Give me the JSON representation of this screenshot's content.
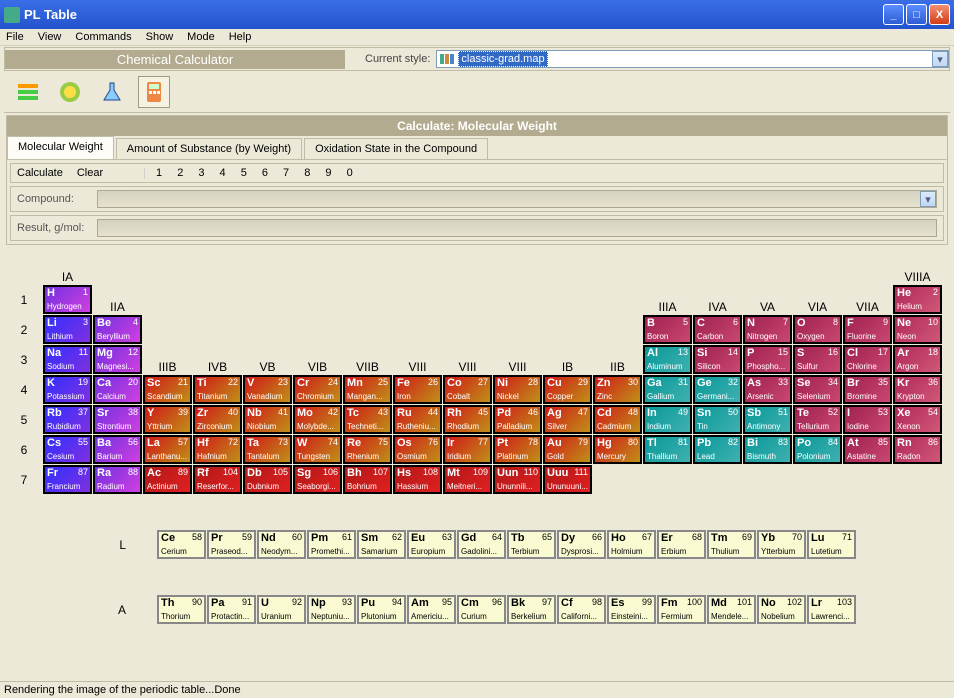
{
  "window": {
    "title": "PL Table"
  },
  "menu": [
    "File",
    "View",
    "Commands",
    "Show",
    "Mode",
    "Help"
  ],
  "header_label": "Chemical Calculator",
  "style": {
    "label": "Current style:",
    "value": "classic-grad.map"
  },
  "panel_title": "Calculate: Molecular Weight",
  "tabs": [
    "Molecular Weight",
    "Amount of Substance (by Weight)",
    "Oxidation State in the Compound"
  ],
  "calc": {
    "btn_calculate": "Calculate",
    "btn_clear": "Clear",
    "digits": "1 2 3 4 5 6 7 8 9 0",
    "compound_label": "Compound:",
    "result_label": "Result, g/mol:"
  },
  "groups": {
    "IA": "IA",
    "IIA": "IIA",
    "IIIB": "IIIB",
    "IVB": "IVB",
    "VB": "VB",
    "VIB": "VIB",
    "VIIB": "VIIB",
    "VIII1": "VIII",
    "VIII2": "VIII",
    "VIII3": "VIII",
    "IB": "IB",
    "IIB": "IIB",
    "IIIA": "IIIA",
    "IVA": "IVA",
    "VA": "VA",
    "VIA": "VIA",
    "VIIA": "VIIA",
    "VIIIA": "VIIIA"
  },
  "periods": [
    "1",
    "2",
    "3",
    "4",
    "5",
    "6",
    "7"
  ],
  "lan_labels": {
    "L": "L",
    "A": "A"
  },
  "elements": {
    "H": {
      "n": "1",
      "nm": "Hydrogen"
    },
    "He": {
      "n": "2",
      "nm": "Helium"
    },
    "Li": {
      "n": "3",
      "nm": "Lithium"
    },
    "Be": {
      "n": "4",
      "nm": "Beryllium"
    },
    "B": {
      "n": "5",
      "nm": "Boron"
    },
    "C": {
      "n": "6",
      "nm": "Carbon"
    },
    "N": {
      "n": "7",
      "nm": "Nitrogen"
    },
    "O": {
      "n": "8",
      "nm": "Oxygen"
    },
    "F": {
      "n": "9",
      "nm": "Fluorine"
    },
    "Ne": {
      "n": "10",
      "nm": "Neon"
    },
    "Na": {
      "n": "11",
      "nm": "Sodium"
    },
    "Mg": {
      "n": "12",
      "nm": "Magnesi..."
    },
    "Al": {
      "n": "13",
      "nm": "Aluminum"
    },
    "Si": {
      "n": "14",
      "nm": "Silicon"
    },
    "P": {
      "n": "15",
      "nm": "Phospho..."
    },
    "S": {
      "n": "16",
      "nm": "Sulfur"
    },
    "Cl": {
      "n": "17",
      "nm": "Chlorine"
    },
    "Ar": {
      "n": "18",
      "nm": "Argon"
    },
    "K": {
      "n": "19",
      "nm": "Potassium"
    },
    "Ca": {
      "n": "20",
      "nm": "Calcium"
    },
    "Sc": {
      "n": "21",
      "nm": "Scandium"
    },
    "Ti": {
      "n": "22",
      "nm": "Titanium"
    },
    "V": {
      "n": "23",
      "nm": "Vanadium"
    },
    "Cr": {
      "n": "24",
      "nm": "Chromium"
    },
    "Mn": {
      "n": "25",
      "nm": "Mangan..."
    },
    "Fe": {
      "n": "26",
      "nm": "Iron"
    },
    "Co": {
      "n": "27",
      "nm": "Cobalt"
    },
    "Ni": {
      "n": "28",
      "nm": "Nickel"
    },
    "Cu": {
      "n": "29",
      "nm": "Copper"
    },
    "Zn": {
      "n": "30",
      "nm": "Zinc"
    },
    "Ga": {
      "n": "31",
      "nm": "Gallium"
    },
    "Ge": {
      "n": "32",
      "nm": "Germani..."
    },
    "As": {
      "n": "33",
      "nm": "Arsenic"
    },
    "Se": {
      "n": "34",
      "nm": "Selenium"
    },
    "Br": {
      "n": "35",
      "nm": "Bromine"
    },
    "Kr": {
      "n": "36",
      "nm": "Krypton"
    },
    "Rb": {
      "n": "37",
      "nm": "Rubidium"
    },
    "Sr": {
      "n": "38",
      "nm": "Strontium"
    },
    "Y": {
      "n": "39",
      "nm": "Yttrium"
    },
    "Zr": {
      "n": "40",
      "nm": "Zirconium"
    },
    "Nb": {
      "n": "41",
      "nm": "Niobium"
    },
    "Mo": {
      "n": "42",
      "nm": "Molybde..."
    },
    "Tc": {
      "n": "43",
      "nm": "Techneti..."
    },
    "Ru": {
      "n": "44",
      "nm": "Rutheniu..."
    },
    "Rh": {
      "n": "45",
      "nm": "Rhodium"
    },
    "Pd": {
      "n": "46",
      "nm": "Palladium"
    },
    "Ag": {
      "n": "47",
      "nm": "Silver"
    },
    "Cd": {
      "n": "48",
      "nm": "Cadmium"
    },
    "In": {
      "n": "49",
      "nm": "Indium"
    },
    "Sn": {
      "n": "50",
      "nm": "Tin"
    },
    "Sb": {
      "n": "51",
      "nm": "Antimony"
    },
    "Te": {
      "n": "52",
      "nm": "Tellurium"
    },
    "I": {
      "n": "53",
      "nm": "Iodine"
    },
    "Xe": {
      "n": "54",
      "nm": "Xenon"
    },
    "Cs": {
      "n": "55",
      "nm": "Cesium"
    },
    "Ba": {
      "n": "56",
      "nm": "Barium"
    },
    "La": {
      "n": "57",
      "nm": "Lanthanu..."
    },
    "Hf": {
      "n": "72",
      "nm": "Hafnium"
    },
    "Ta": {
      "n": "73",
      "nm": "Tantalum"
    },
    "W": {
      "n": "74",
      "nm": "Tungsten"
    },
    "Re": {
      "n": "75",
      "nm": "Rhenium"
    },
    "Os": {
      "n": "76",
      "nm": "Osmium"
    },
    "Ir": {
      "n": "77",
      "nm": "Iridium"
    },
    "Pt": {
      "n": "78",
      "nm": "Platinum"
    },
    "Au": {
      "n": "79",
      "nm": "Gold"
    },
    "Hg": {
      "n": "80",
      "nm": "Mercury"
    },
    "Tl": {
      "n": "81",
      "nm": "Thallium"
    },
    "Pb": {
      "n": "82",
      "nm": "Lead"
    },
    "Bi": {
      "n": "83",
      "nm": "Bismuth"
    },
    "Po": {
      "n": "84",
      "nm": "Polonium"
    },
    "At": {
      "n": "85",
      "nm": "Astatine"
    },
    "Rn": {
      "n": "86",
      "nm": "Radon"
    },
    "Fr": {
      "n": "87",
      "nm": "Francium"
    },
    "Ra": {
      "n": "88",
      "nm": "Radium"
    },
    "Ac": {
      "n": "89",
      "nm": "Actinium"
    },
    "Rf": {
      "n": "104",
      "nm": "Reserfor..."
    },
    "Db": {
      "n": "105",
      "nm": "Dubnium"
    },
    "Sg": {
      "n": "106",
      "nm": "Seaborgi..."
    },
    "Bh": {
      "n": "107",
      "nm": "Bohrium"
    },
    "Hs": {
      "n": "108",
      "nm": "Hassium"
    },
    "Mt": {
      "n": "109",
      "nm": "Meitneri..."
    },
    "Uun": {
      "n": "110",
      "nm": "Ununnili..."
    },
    "Uuu": {
      "n": "111",
      "nm": "Ununuuni..."
    },
    "Ce": {
      "n": "58",
      "nm": "Cerium"
    },
    "Pr": {
      "n": "59",
      "nm": "Praseod..."
    },
    "Nd": {
      "n": "60",
      "nm": "Neodym..."
    },
    "Pm": {
      "n": "61",
      "nm": "Promethi..."
    },
    "Sm": {
      "n": "62",
      "nm": "Samarium"
    },
    "Eu": {
      "n": "63",
      "nm": "Europium"
    },
    "Gd": {
      "n": "64",
      "nm": "Gadolini..."
    },
    "Tb": {
      "n": "65",
      "nm": "Terbium"
    },
    "Dy": {
      "n": "66",
      "nm": "Dysprosi..."
    },
    "Ho": {
      "n": "67",
      "nm": "Holmium"
    },
    "Er": {
      "n": "68",
      "nm": "Erbium"
    },
    "Tm": {
      "n": "69",
      "nm": "Thulium"
    },
    "Yb": {
      "n": "70",
      "nm": "Ytterbium"
    },
    "Lu": {
      "n": "71",
      "nm": "Lutetium"
    },
    "Th": {
      "n": "90",
      "nm": "Thorium"
    },
    "Pa": {
      "n": "91",
      "nm": "Protactin..."
    },
    "U": {
      "n": "92",
      "nm": "Uranium"
    },
    "Np": {
      "n": "93",
      "nm": "Neptuniu..."
    },
    "Pu": {
      "n": "94",
      "nm": "Plutonium"
    },
    "Am": {
      "n": "95",
      "nm": "Americiu..."
    },
    "Cm": {
      "n": "96",
      "nm": "Curium"
    },
    "Bk": {
      "n": "97",
      "nm": "Berkelium"
    },
    "Cf": {
      "n": "98",
      "nm": "Californi..."
    },
    "Es": {
      "n": "99",
      "nm": "Einsteini..."
    },
    "Fm": {
      "n": "100",
      "nm": "Fermium"
    },
    "Md": {
      "n": "101",
      "nm": "Mendele..."
    },
    "No": {
      "n": "102",
      "nm": "Nobelium"
    },
    "Lr": {
      "n": "103",
      "nm": "Lawrenci..."
    }
  },
  "status": "Rendering the image of the periodic table...Done"
}
